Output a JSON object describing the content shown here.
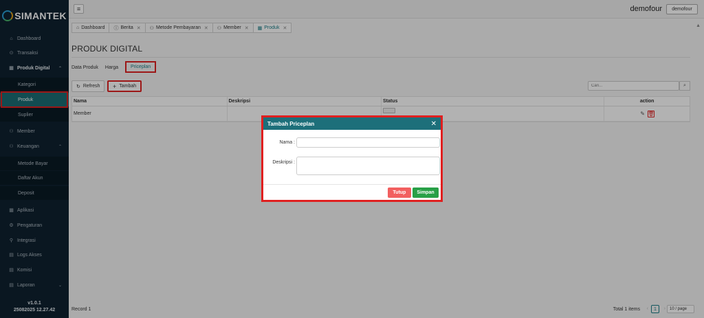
{
  "app": {
    "logo_text": "SIMANTEK",
    "logo_sub": "",
    "user_name": "demofour",
    "user_button": "demofour",
    "version": "v1.0.1",
    "build": "25082025 12.27.42"
  },
  "sidebar": {
    "items": [
      {
        "label": "Dashboard",
        "icon": "home-icon"
      },
      {
        "label": "Transaksi",
        "icon": "transaction-icon"
      },
      {
        "label": "Produk Digital",
        "icon": "grid-icon"
      },
      {
        "label": "Kategori"
      },
      {
        "label": "Produk"
      },
      {
        "label": "Suplier"
      },
      {
        "label": "Member",
        "icon": "users-icon"
      },
      {
        "label": "Keuangan",
        "icon": "finance-icon"
      },
      {
        "label": "Metode Bayar"
      },
      {
        "label": "Daftar Akun"
      },
      {
        "label": "Deposit"
      },
      {
        "label": "Aplikasi",
        "icon": "app-icon"
      },
      {
        "label": "Pengaturan",
        "icon": "settings-icon"
      },
      {
        "label": "Integrasi",
        "icon": "plug-icon"
      },
      {
        "label": "Logs Akses",
        "icon": "log-icon"
      },
      {
        "label": "Komisi",
        "icon": "commission-icon"
      },
      {
        "label": "Laporan",
        "icon": "report-icon"
      }
    ]
  },
  "tabs": [
    {
      "label": "Dashboard",
      "icon": "home-icon"
    },
    {
      "label": "Berita",
      "icon": "info-icon"
    },
    {
      "label": "Metode Pembayaran",
      "icon": "users-icon"
    },
    {
      "label": "Member",
      "icon": "users-icon"
    },
    {
      "label": "Produk",
      "icon": "grid-icon"
    }
  ],
  "page": {
    "title": "PRODUK DIGITAL",
    "subtabs": [
      "Data Produk",
      "Harga",
      "Priceplan"
    ],
    "refresh_label": "Refresh",
    "add_label": "Tambah",
    "search_placeholder": "Cari..."
  },
  "table": {
    "headers": [
      "Nama",
      "Deskripsi",
      "Status",
      "action"
    ],
    "rows": [
      {
        "nama": "Member",
        "deskripsi": "",
        "status": ""
      }
    ]
  },
  "footer": {
    "record": "Record 1",
    "total": "Total 1 items",
    "page": "1",
    "per_page": "10 / page"
  },
  "modal": {
    "title": "Tambah Priceplan",
    "nama_label": "Nama :",
    "deskripsi_label": "Deskripsi :",
    "nama_value": "",
    "deskripsi_value": "",
    "cancel_label": "Tutup",
    "save_label": "Simpan"
  },
  "colors": {
    "sidebar_bg": "#0f2230",
    "accent": "#1a7d87",
    "modal_header": "#1d6f7a",
    "danger": "#f25f5f",
    "success": "#28a047",
    "highlight": "#e02222"
  }
}
